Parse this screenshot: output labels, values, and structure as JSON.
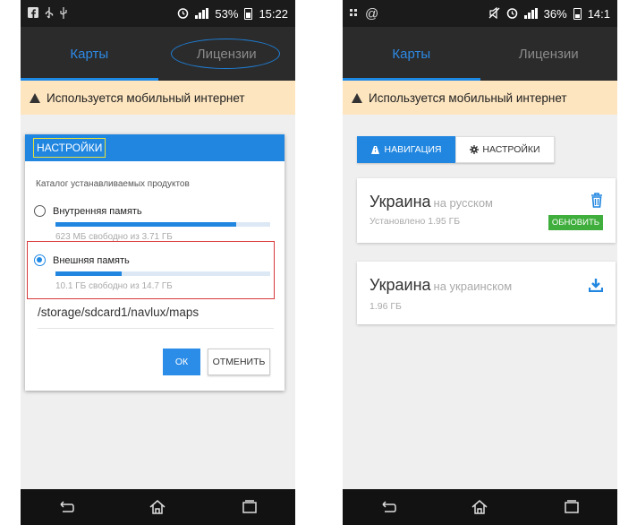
{
  "left": {
    "status": {
      "battery_pct": "53%",
      "time": "15:22",
      "icons": [
        "facebook-icon",
        "usb-icon",
        "alarm-icon",
        "signal-icon",
        "battery-icon"
      ]
    },
    "tabs": [
      {
        "label": "Карты",
        "active": true
      },
      {
        "label": "Лицензии",
        "active": false
      }
    ],
    "warning": "Используется мобильный интернет",
    "dialog": {
      "title": "НАСТРОЙКИ",
      "subtitle": "Каталог устанавливаемых продуктов",
      "options": [
        {
          "label": "Внутренняя память",
          "free": "623 МБ свободно из 3.71 ГБ",
          "selected": false,
          "usage": 0.84
        },
        {
          "label": "Внешняя память",
          "free": "10.1 ГБ свободно из 14.7 ГБ",
          "selected": true,
          "usage": 0.31
        }
      ],
      "path": "/storage/sdcard1/navlux/maps",
      "ok_label": "ОК",
      "cancel_label": "ОТМЕНИТЬ"
    }
  },
  "right": {
    "status": {
      "battery_pct": "36%",
      "time": "14:1",
      "icons": [
        "sim-icon",
        "at-icon",
        "mute-icon",
        "alarm-icon",
        "signal-icon",
        "battery-icon"
      ]
    },
    "tabs": [
      {
        "label": "Карты",
        "active": true
      },
      {
        "label": "Лицензии",
        "active": false
      }
    ],
    "warning": "Используется мобильный интернет",
    "segment": {
      "nav_label": "НАВИГАЦИЯ",
      "settings_label": "НАСТРОЙКИ"
    },
    "cards": [
      {
        "country": "Украина",
        "lang": "на русском",
        "info": "Установлено 1.95 ГБ",
        "action": "ОБНОВИТЬ"
      },
      {
        "country": "Украина",
        "lang": "на украинском",
        "info": "1.96 ГБ"
      }
    ]
  },
  "colors": {
    "accent": "#2086e0",
    "warning_bg": "#fde5bf",
    "update_green": "#3fae3c",
    "highlight_red": "#d93a3a",
    "highlight_yellow": "#e8e23a"
  }
}
